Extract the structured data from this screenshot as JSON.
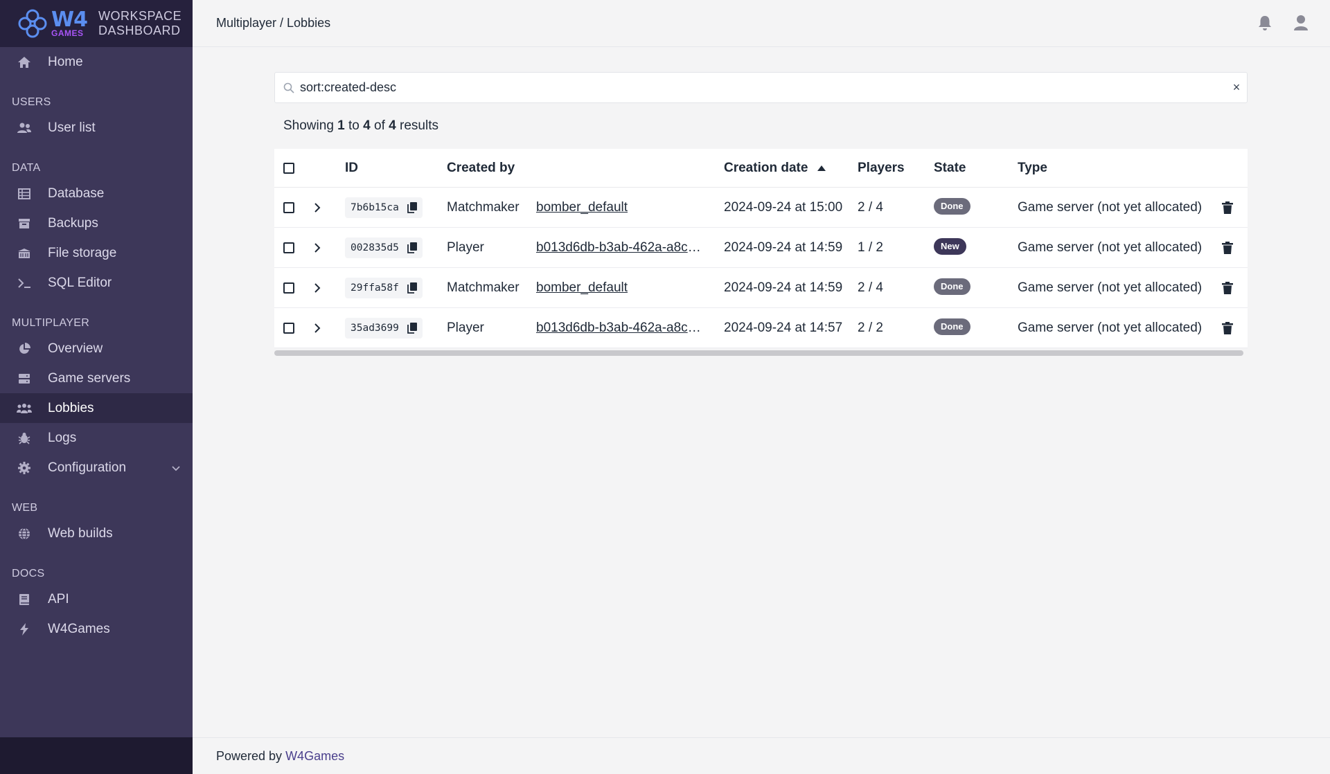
{
  "brand": {
    "logo_main": "W4",
    "logo_sub": "GAMES",
    "title_line1": "WORKSPACE",
    "title_line2": "DASHBOARD"
  },
  "sidebar": {
    "home": {
      "label": "Home",
      "icon": "home-icon"
    },
    "sections": [
      {
        "title": "USERS",
        "items": [
          {
            "label": "User list",
            "icon": "users-icon"
          }
        ]
      },
      {
        "title": "DATA",
        "items": [
          {
            "label": "Database",
            "icon": "table-icon"
          },
          {
            "label": "Backups",
            "icon": "archive-icon"
          },
          {
            "label": "File storage",
            "icon": "storage-icon"
          },
          {
            "label": "SQL Editor",
            "icon": "terminal-icon"
          }
        ]
      },
      {
        "title": "MULTIPLAYER",
        "items": [
          {
            "label": "Overview",
            "icon": "pie-chart-icon"
          },
          {
            "label": "Game servers",
            "icon": "server-icon"
          },
          {
            "label": "Lobbies",
            "icon": "group-icon"
          },
          {
            "label": "Logs",
            "icon": "bug-icon"
          },
          {
            "label": "Configuration",
            "icon": "gear-icon"
          }
        ]
      },
      {
        "title": "WEB",
        "items": [
          {
            "label": "Web builds",
            "icon": "globe-icon"
          }
        ]
      },
      {
        "title": "DOCS",
        "items": [
          {
            "label": "API",
            "icon": "book-icon"
          },
          {
            "label": "W4Games",
            "icon": "bolt-icon"
          }
        ]
      }
    ]
  },
  "topbar": {
    "breadcrumb": "Multiplayer / Lobbies"
  },
  "search": {
    "value": "sort:created-desc",
    "clear_label": "×"
  },
  "results": {
    "prefix": "Showing",
    "from": "1",
    "to_word": "to",
    "to": "4",
    "of_word": "of",
    "total": "4",
    "suffix": "results"
  },
  "table": {
    "headers": {
      "id": "ID",
      "created_by": "Created by",
      "creation_date": "Creation date",
      "players": "Players",
      "state": "State",
      "type": "Type"
    },
    "rows": [
      {
        "id": "7b6b15ca",
        "creator_type": "Matchmaker",
        "creator": "bomber_default",
        "date": "2024-09-24 at 15:00",
        "players": "2 / 4",
        "state": "Done",
        "type": "Game server (not yet allocated)"
      },
      {
        "id": "002835d5",
        "creator_type": "Player",
        "creator": "b013d6db-b3ab-462a-a8c4…",
        "date": "2024-09-24 at 14:59",
        "players": "1 / 2",
        "state": "New",
        "type": "Game server (not yet allocated)"
      },
      {
        "id": "29ffa58f",
        "creator_type": "Matchmaker",
        "creator": "bomber_default",
        "date": "2024-09-24 at 14:59",
        "players": "2 / 4",
        "state": "Done",
        "type": "Game server (not yet allocated)"
      },
      {
        "id": "35ad3699",
        "creator_type": "Player",
        "creator": "b013d6db-b3ab-462a-a8c4…",
        "date": "2024-09-24 at 14:57",
        "players": "2 / 2",
        "state": "Done",
        "type": "Game server (not yet allocated)"
      }
    ]
  },
  "footer": {
    "text": "Powered by",
    "link": "W4Games"
  },
  "colors": {
    "sidebar_bg": "#3d3759",
    "sidebar_header_bg": "#26213d",
    "accent": "#4a3f8c",
    "badge_done": "#6b6b7b",
    "badge_new": "#3d3759"
  }
}
